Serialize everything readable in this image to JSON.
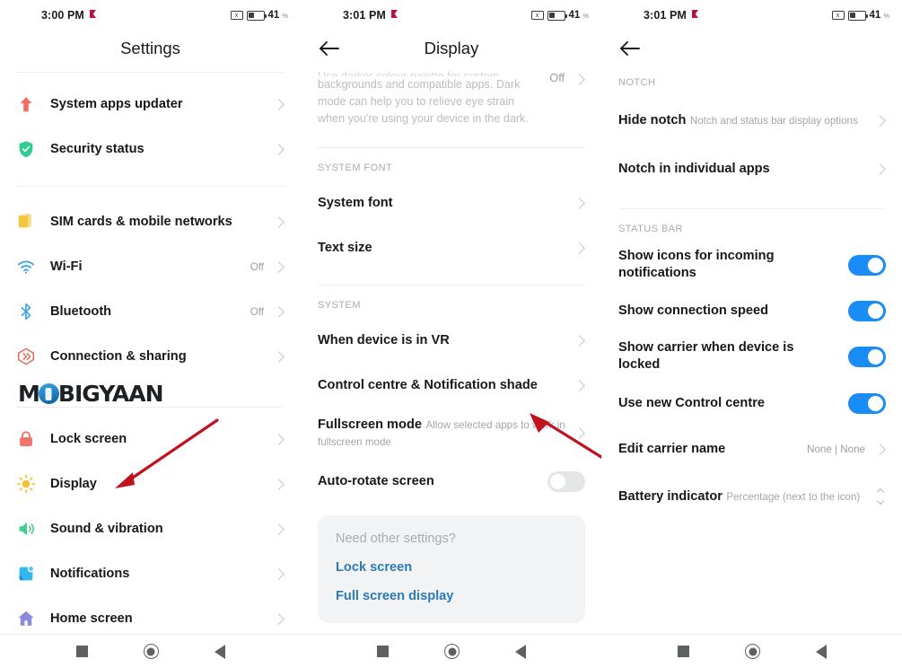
{
  "statusbar": {
    "time_left": "3:00 PM",
    "time_mid": "3:01 PM",
    "time_right": "3:01 PM",
    "battery_percent": "41",
    "percent_sign": "%",
    "nosim_glyph": "x"
  },
  "settings_screen": {
    "title": "Settings",
    "watermark": {
      "part1": "M",
      "part2": "BIGYAAN"
    },
    "groups": [
      {
        "items": [
          {
            "label": "System apps updater",
            "icon": "upload-arrow-icon",
            "value": "",
            "chevron": true
          },
          {
            "label": "Security status",
            "icon": "shield-check-icon",
            "value": "",
            "chevron": true
          }
        ]
      },
      {
        "items": [
          {
            "label": "SIM cards & mobile networks",
            "icon": "sim-card-icon",
            "value": "",
            "chevron": true
          },
          {
            "label": "Wi-Fi",
            "icon": "wifi-icon",
            "value": "Off",
            "chevron": true
          },
          {
            "label": "Bluetooth",
            "icon": "bluetooth-icon",
            "value": "Off",
            "chevron": true
          },
          {
            "label": "Connection & sharing",
            "icon": "connection-sharing-icon",
            "value": "",
            "chevron": true
          }
        ]
      },
      {
        "items": [
          {
            "label": "Lock screen",
            "icon": "lock-icon",
            "value": "",
            "chevron": true
          },
          {
            "label": "Display",
            "icon": "brightness-sun-icon",
            "value": "",
            "chevron": true
          },
          {
            "label": "Sound & vibration",
            "icon": "speaker-icon",
            "value": "",
            "chevron": true
          },
          {
            "label": "Notifications",
            "icon": "notifications-icon",
            "value": "",
            "chevron": true
          },
          {
            "label": "Home screen",
            "icon": "home-icon",
            "value": "",
            "chevron": true
          }
        ]
      }
    ]
  },
  "display_screen": {
    "title": "Display",
    "back_icon": "back-arrow-icon",
    "dark_mode": {
      "clipped_line": "Use darker colour palette for system",
      "description": "backgrounds and compatible apps. Dark mode can help you to relieve eye strain when you're using your device in the dark.",
      "value": "Off"
    },
    "section_system_font": "SYSTEM FONT",
    "font_items": [
      {
        "label": "System font",
        "chevron": true
      },
      {
        "label": "Text size",
        "chevron": true
      }
    ],
    "section_system": "SYSTEM",
    "system_items": [
      {
        "label": "When device is in VR",
        "sub": "",
        "chevron": true
      },
      {
        "label": "Control centre & Notification shade",
        "sub": "",
        "chevron": true
      },
      {
        "label": "Fullscreen mode",
        "sub": "Allow selected apps to work in fullscreen mode",
        "chevron": true
      }
    ],
    "auto_rotate": {
      "label": "Auto-rotate screen",
      "state": "off"
    },
    "card": {
      "title": "Need other settings?",
      "links": [
        "Lock screen",
        "Full screen display"
      ]
    }
  },
  "control_centre_screen": {
    "back_icon": "back-arrow-icon",
    "section_notch": "NOTCH",
    "notch_items": [
      {
        "label": "Hide notch",
        "sub": "Notch and status bar display options",
        "chevron": true
      },
      {
        "label": "Notch in individual apps",
        "sub": "",
        "chevron": true
      }
    ],
    "section_status_bar": "STATUS BAR",
    "status_items": [
      {
        "label": "Show icons for incoming notifications",
        "type": "toggle",
        "state": "on"
      },
      {
        "label": "Show connection speed",
        "type": "toggle",
        "state": "on"
      },
      {
        "label": "Show carrier when device is locked",
        "type": "toggle",
        "state": "on"
      },
      {
        "label": "Use new Control centre",
        "type": "toggle",
        "state": "on"
      },
      {
        "label": "Edit carrier name",
        "type": "value",
        "value": "None | None",
        "chevron": true
      },
      {
        "label": "Battery indicator",
        "sub": "Percentage (next to the icon)",
        "type": "stepper"
      }
    ]
  },
  "navbar": {
    "recents": "recents-square-icon",
    "home": "home-circle-icon",
    "back": "back-triangle-icon"
  },
  "colors": {
    "toggle_on": "#1a8cf5",
    "toggle_off": "#e3e5e7",
    "link": "#2c7ab8",
    "annotation_arrow": "#c1121f"
  }
}
